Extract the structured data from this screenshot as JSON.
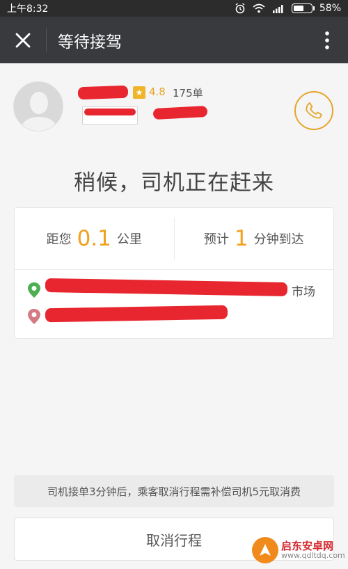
{
  "status_bar": {
    "time": "上午8:32",
    "battery": "58%",
    "battery_level": 0.58
  },
  "header": {
    "title": "等待接驾",
    "close_icon": "close-icon",
    "more_icon": "more-vertical-icon"
  },
  "driver": {
    "rating": "4.8",
    "orders": "175单",
    "phone_icon": "phone-icon"
  },
  "headline": "稍候，司机正在赶来",
  "eta": {
    "distance_prefix": "距您",
    "distance_value": "0.1",
    "distance_unit": "公里",
    "time_prefix": "预计",
    "time_value": "1",
    "time_unit": "分钟到达"
  },
  "route": {
    "pickup_suffix": "市场"
  },
  "notice": "司机接单3分钟后，乘客取消行程需补偿司机5元取消费",
  "actions": {
    "cancel_label": "取消行程"
  },
  "watermark": {
    "title": "启东安卓网",
    "url": "www.qdltdq.com"
  },
  "colors": {
    "accent": "#f0a11e",
    "redact": "#e8262f",
    "pickup": "#4caf50",
    "dropoff": "#d47a84"
  }
}
